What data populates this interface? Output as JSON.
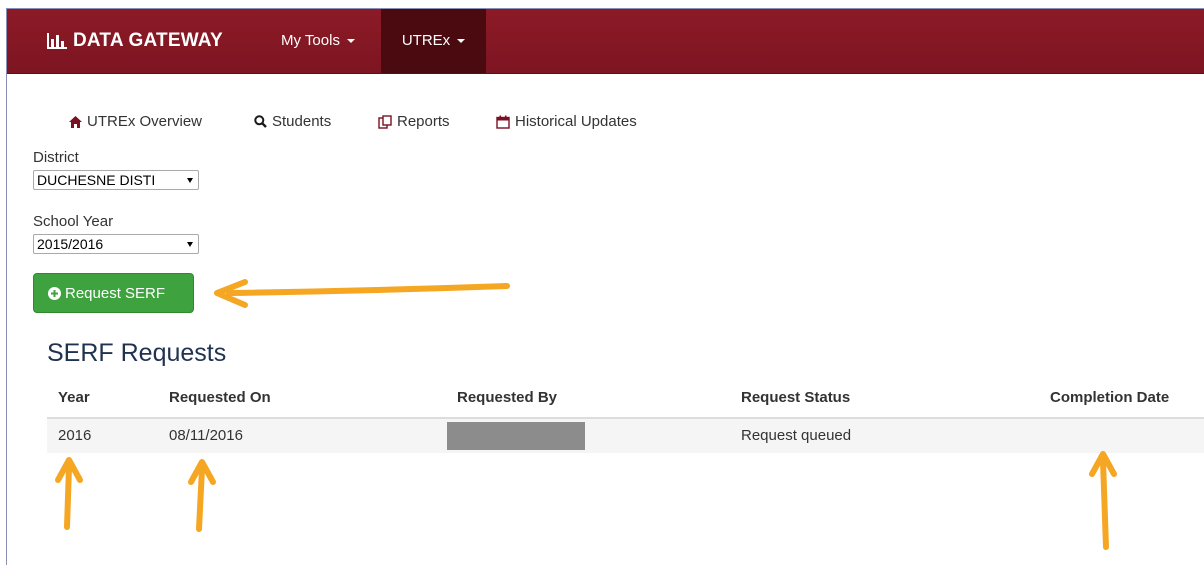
{
  "topnav": {
    "brand": "DATA GATEWAY",
    "brand_icon": "bar-chart-icon",
    "items": [
      {
        "label": "My Tools",
        "active": false
      },
      {
        "label": "UTREx",
        "active": true
      }
    ]
  },
  "subnav": {
    "items": [
      {
        "label": "UTREx Overview",
        "icon": "home-icon"
      },
      {
        "label": "Students",
        "icon": "search-icon"
      },
      {
        "label": "Reports",
        "icon": "copy-icon"
      },
      {
        "label": "Historical Updates",
        "icon": "calendar-icon"
      }
    ]
  },
  "filters": {
    "district_label": "District",
    "district_value": "DUCHESNE DISTI",
    "school_year_label": "School Year",
    "school_year_value": "2015/2016"
  },
  "request_button": {
    "label": "Request SERF",
    "icon": "plus-circle-icon"
  },
  "serf": {
    "title": "SERF Requests",
    "columns": [
      "Year",
      "Requested On",
      "Requested By",
      "Request Status",
      "Completion Date"
    ],
    "rows": [
      {
        "year": "2016",
        "requested_on": "08/11/2016",
        "requested_by": "",
        "status": "Request queued",
        "completion_date": ""
      }
    ]
  },
  "colors": {
    "navbar": "#8c1a26",
    "navbar_active": "#4a0a10",
    "button_green": "#3ea33e",
    "annotation_arrow": "#f5a623",
    "title_blue": "#1f3350"
  }
}
